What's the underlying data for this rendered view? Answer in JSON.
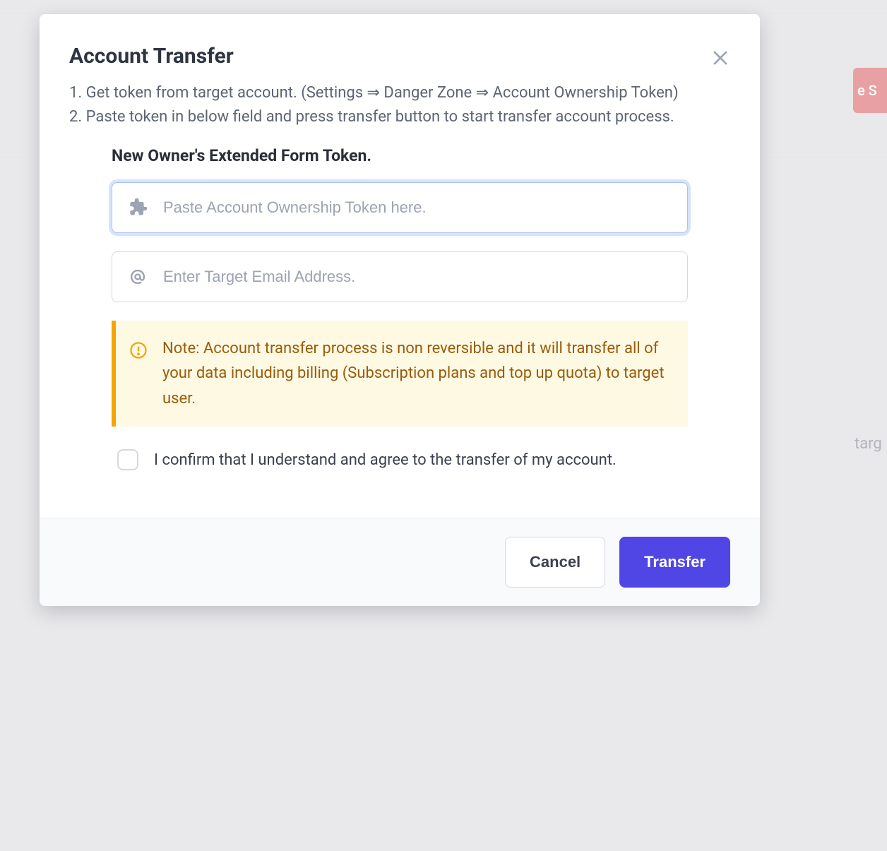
{
  "modal": {
    "title": "Account Transfer",
    "description": "1. Get token from target account. (Settings ⇒ Danger Zone ⇒ Account Ownership Token)\n2. Paste token in below field and press transfer button to start transfer account process.",
    "section_title": "New Owner's Extended Form Token.",
    "token_input": {
      "value": "",
      "placeholder": "Paste Account Ownership Token here."
    },
    "email_input": {
      "value": "",
      "placeholder": "Enter Target Email Address."
    },
    "alert": "Note: Account transfer process is non reversible and it will transfer all of your data including billing (Subscription plans and top up quota) to target user.",
    "confirm_text": "I confirm that I understand and agree to the transfer of my account.",
    "buttons": {
      "cancel": "Cancel",
      "transfer": "Transfer"
    }
  },
  "background": {
    "badge_text": "e S",
    "tag_text": "targ"
  }
}
